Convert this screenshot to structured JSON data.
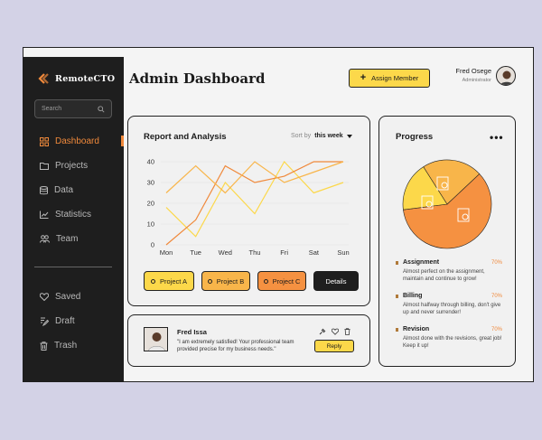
{
  "app": {
    "logo_text": "RemoteCTO"
  },
  "sidebar": {
    "search_placeholder": "Search",
    "items": [
      {
        "label": "Dashboard",
        "icon": "grid-icon",
        "active": true
      },
      {
        "label": "Projects",
        "icon": "folder-icon"
      },
      {
        "label": "Data",
        "icon": "database-icon"
      },
      {
        "label": "Statistics",
        "icon": "chart-icon"
      },
      {
        "label": "Team",
        "icon": "team-icon"
      }
    ],
    "bottom_items": [
      {
        "label": "Saved",
        "icon": "heart-icon"
      },
      {
        "label": "Draft",
        "icon": "draft-icon"
      },
      {
        "label": "Trash",
        "icon": "trash-icon"
      }
    ]
  },
  "header": {
    "title": "Admin Dashboard",
    "assign_button": "Assign Member",
    "user_name": "Fred Osege",
    "user_role": "Administrator"
  },
  "report": {
    "title": "Report and Analysis",
    "sort_label": "Sort by",
    "sort_value": "this week",
    "projects": [
      "Project A",
      "Project B",
      "Project C"
    ],
    "details_button": "Details"
  },
  "chart_data": {
    "type": "line",
    "categories": [
      "Mon",
      "Tue",
      "Wed",
      "Thu",
      "Fri",
      "Sat",
      "Sun"
    ],
    "yticks": [
      0,
      10,
      20,
      30,
      40
    ],
    "ylim": [
      0,
      40
    ],
    "series": [
      {
        "values": [
          18,
          4,
          30,
          15,
          40,
          25,
          30
        ],
        "color": "#fcd84a"
      },
      {
        "values": [
          0,
          12,
          38,
          30,
          33,
          40,
          40
        ],
        "color": "#f0893b"
      },
      {
        "values": [
          25,
          38,
          25,
          40,
          30,
          35,
          40
        ],
        "color": "#f8b54a"
      }
    ],
    "grid": true
  },
  "progress": {
    "title": "Progress",
    "pie": [
      {
        "value": 60,
        "color": "#f59141"
      },
      {
        "value": 18,
        "color": "#fcd84a"
      },
      {
        "value": 22,
        "color": "#f8b54a"
      }
    ],
    "tasks": [
      {
        "name": "Assignment",
        "pct": "70%",
        "desc": "Almost perfect on the assignment, maintain and continue to grow!"
      },
      {
        "name": "Billing",
        "pct": "70%",
        "desc": "Almost halfway through billing, don't give up and never surrender!"
      },
      {
        "name": "Revision",
        "pct": "70%",
        "desc": "Almost done with the revisions, great job! Keep it up!"
      }
    ]
  },
  "review": {
    "name": "Fred Issa",
    "text": "\"I am extremely satisfied! Your professional team provided precise for my business needs.\"",
    "reply_button": "Reply"
  },
  "colors": {
    "accent_orange": "#f0893b",
    "accent_yellow": "#fcd84a",
    "sidebar_bg": "#1e1e1e"
  }
}
